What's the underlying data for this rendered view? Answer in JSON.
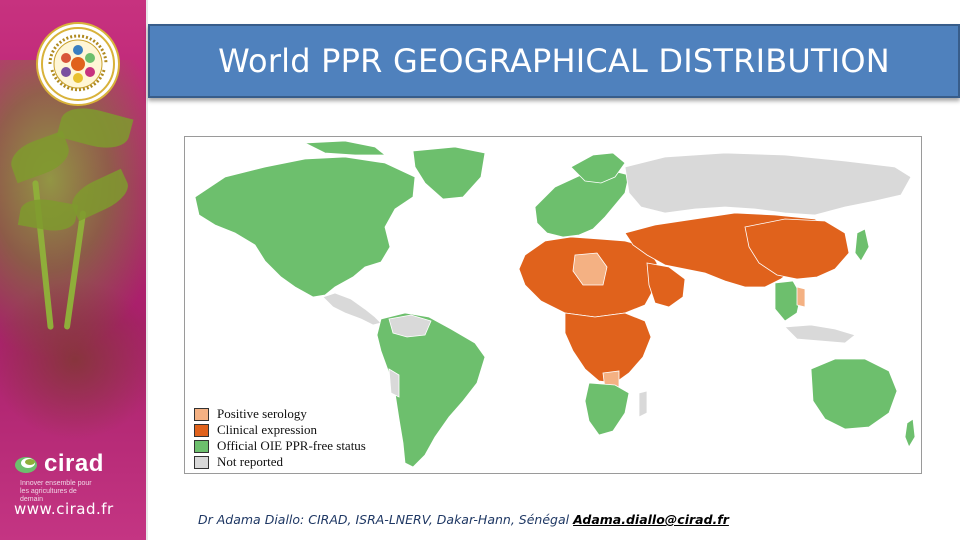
{
  "title": "World PPR GEOGRAPHICAL DISTRIBUTION",
  "seal": {
    "text": "Les Rencontres du Cirad"
  },
  "brand": {
    "name": "cirad",
    "tagline": "Innover ensemble pour les agricultures de demain",
    "url": "www.cirad.fr"
  },
  "legend": [
    {
      "label": "Positive serology",
      "color": "#f4b183"
    },
    {
      "label": "Clinical expression",
      "color": "#e0621c"
    },
    {
      "label": "Official OIE PPR-free status",
      "color": "#6dbf6d"
    },
    {
      "label": "Not reported",
      "color": "#d9d9d9"
    }
  ],
  "footer": {
    "credit": "Dr Adama Diallo: CIRAD, ISRA-LNERV, Dakar-Hann, Sénégal",
    "email": "Adama.diallo@cirad.fr"
  },
  "map_colors": {
    "positive_serology": "#f4b183",
    "clinical": "#e0621c",
    "free": "#6dbf6d",
    "not_reported": "#d9d9d9",
    "border": "#ffffff"
  }
}
